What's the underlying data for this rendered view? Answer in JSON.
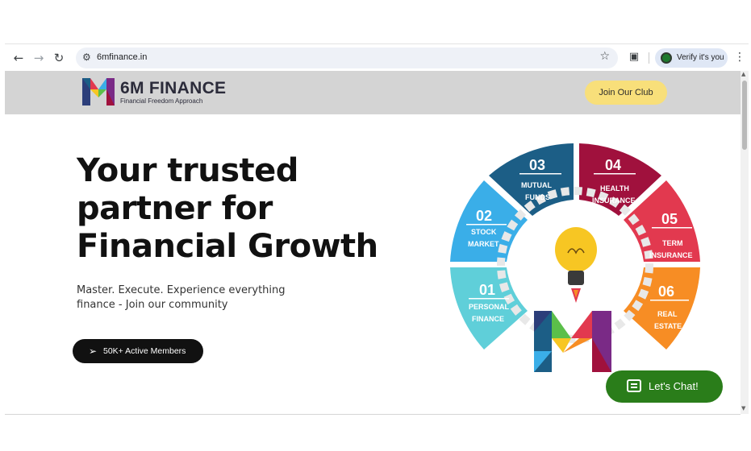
{
  "browser": {
    "url": "6mfinance.in",
    "verify_label": "Verify it's you",
    "icons": [
      "back-icon",
      "forward-icon",
      "reload-icon",
      "site-settings-icon",
      "bookmark-star-icon",
      "extensions-icon",
      "menu-kebab-icon"
    ]
  },
  "header": {
    "brand_name": "6M FINANCE",
    "brand_tagline": "Financial Freedom Approach",
    "join_label": "Join Our Club"
  },
  "hero": {
    "title_line1": "Your trusted",
    "title_line2": "partner for",
    "title_line3": "Financial Growth",
    "subtitle_line1": "Master. Execute. Experience everything",
    "subtitle_line2": "finance - Join our community",
    "members_label": "50K+ Active Members"
  },
  "wheel": {
    "segments": [
      {
        "num": "01",
        "line1": "PERSONAL",
        "line2": "FINANCE",
        "color": "#5fcfd9"
      },
      {
        "num": "02",
        "line1": "STOCK",
        "line2": "MARKET",
        "color": "#3aaee8"
      },
      {
        "num": "03",
        "line1": "MUTUAL",
        "line2": "FUNDS",
        "color": "#1c5e86"
      },
      {
        "num": "04",
        "line1": "HEALTH",
        "line2": "INSURANCE",
        "color": "#a0113d"
      },
      {
        "num": "05",
        "line1": "TERM",
        "line2": "INSURANCE",
        "color": "#e2394f"
      },
      {
        "num": "06",
        "line1": "REAL",
        "line2": "ESTATE",
        "color": "#f78d24"
      }
    ]
  },
  "chat": {
    "label": "Let's Chat!"
  },
  "colors": {
    "header_bg": "#d4d4d4",
    "join_button": "#f8df7a",
    "chat_button": "#2a7d1a",
    "members_button": "#111111"
  }
}
